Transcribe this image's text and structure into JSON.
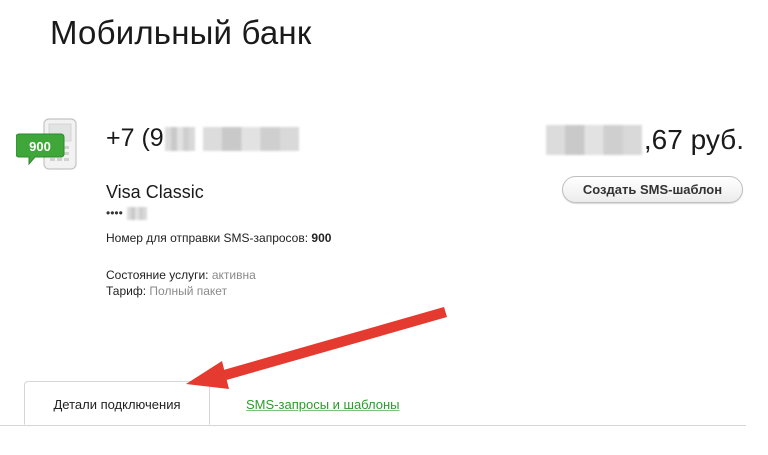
{
  "page": {
    "title": "Мобильный банк"
  },
  "service": {
    "phone_prefix": "+7 (9",
    "balance_suffix": ",67 руб.",
    "create_template_label": "Создать SMS-шаблон",
    "card_name": "Visa Classic",
    "card_mask": "••••",
    "sms_number_label": "Номер для отправки SMS-запросов:",
    "sms_number_value": "900",
    "status_label": "Состояние услуги:",
    "status_value": "активна",
    "tariff_label": "Тариф:",
    "tariff_value": "Полный пакет",
    "icon_badge": "900"
  },
  "tabs": [
    {
      "label": "Детали подключения",
      "active": true
    },
    {
      "label": "SMS-запросы и шаблоны",
      "active": false
    }
  ],
  "colors": {
    "accent_green": "#2e9a2e",
    "icon_green": "#3fa63a",
    "arrow_red": "#e53a2f"
  },
  "icons": {
    "phone": "mobile-phone-icon"
  }
}
